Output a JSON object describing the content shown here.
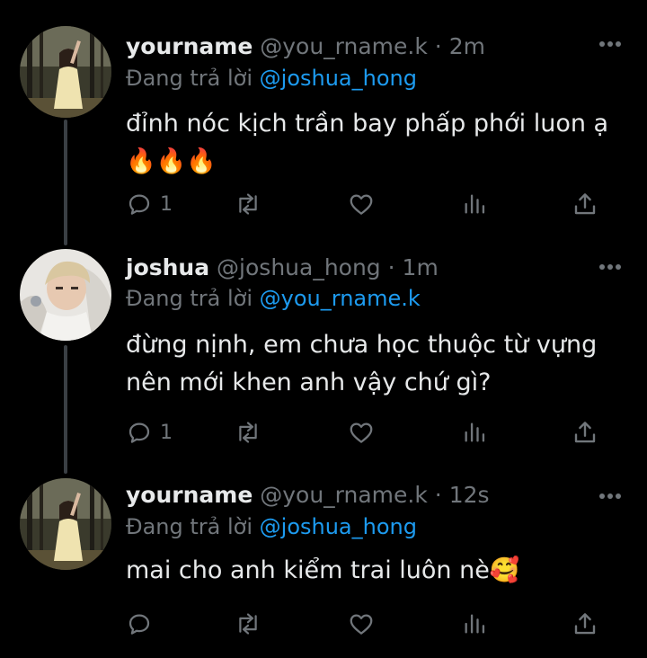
{
  "tweets": [
    {
      "display_name": "yourname",
      "handle": "@you_rname.k",
      "time": "2m",
      "replying_prefix": "Đang trả lời",
      "replying_to": "@joshua_hong",
      "text": "đỉnh nóc kịch trần bay phấp phới luon ạ🔥🔥🔥",
      "reply_count": "1",
      "avatar_icon": "profile-photo-girl-forest"
    },
    {
      "display_name": "joshua",
      "handle": "@joshua_hong",
      "time": "1m",
      "replying_prefix": "Đang trả lời",
      "replying_to": "@you_rname.k",
      "text": "đừng nịnh, em chưa học thuộc từ vựng nên mới khen anh vậy chứ gì?",
      "reply_count": "1",
      "avatar_icon": "profile-photo-boy-white"
    },
    {
      "display_name": "yourname",
      "handle": "@you_rname.k",
      "time": "12s",
      "replying_prefix": "Đang trả lời",
      "replying_to": "@joshua_hong",
      "text": "mai cho anh kiểm trai luôn nè🥰",
      "reply_count": "",
      "avatar_icon": "profile-photo-girl-forest"
    }
  ],
  "colors": {
    "background": "#000000",
    "text_primary": "#e7e9ea",
    "text_secondary": "#71767b",
    "link": "#1d9bf0",
    "thread_line": "#3a3f44"
  },
  "icons": {
    "more": "more-horizontal-icon",
    "reply": "reply-icon",
    "retweet": "retweet-icon",
    "like": "heart-icon",
    "views": "views-icon",
    "share": "share-icon"
  }
}
